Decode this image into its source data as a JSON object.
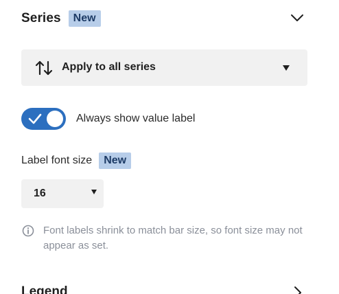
{
  "series_section": {
    "title": "Series",
    "badge": "New",
    "toggle_icon": "chevron-down-icon"
  },
  "apply_select": {
    "icon": "sort-arrows-icon",
    "selected": "Apply to all series"
  },
  "value_label_toggle": {
    "checked": true,
    "label": "Always show value label"
  },
  "font_size": {
    "label": "Label font size",
    "badge": "New",
    "selected": "16"
  },
  "info": {
    "icon": "info-icon",
    "text": "Font labels shrink to match bar size, so font size may not appear as set."
  },
  "legend_section": {
    "title": "Legend",
    "toggle_icon": "chevron-right-icon"
  },
  "colors": {
    "accent": "#2c6fbf",
    "badge_bg": "#b7cde9",
    "badge_text": "#1d3b66",
    "field_bg": "#f1f1f1",
    "muted_text": "#8a8f99"
  }
}
